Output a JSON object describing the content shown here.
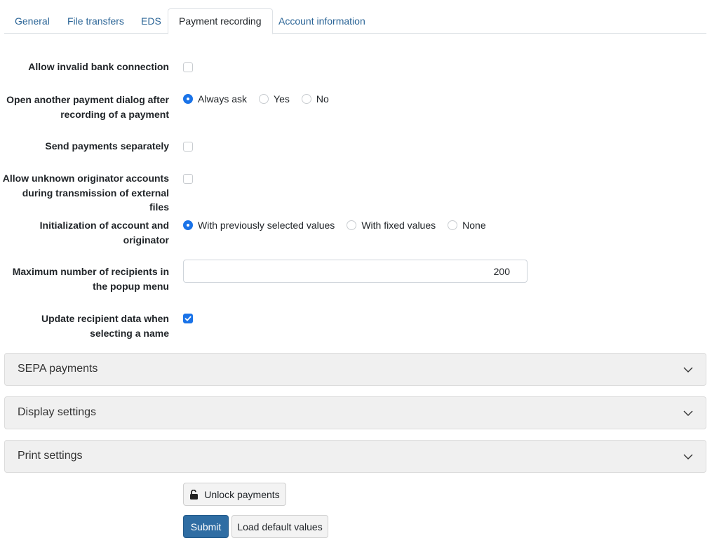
{
  "tabs": [
    {
      "label": "General",
      "active": false
    },
    {
      "label": "File transfers",
      "active": false
    },
    {
      "label": "EDS",
      "active": false
    },
    {
      "label": "Payment recording",
      "active": true
    },
    {
      "label": "Account information",
      "active": false
    }
  ],
  "form": {
    "allow_invalid_bank": {
      "label": "Allow invalid bank connection",
      "checked": false
    },
    "open_another_dialog": {
      "label_line1": "Open another payment dialog after",
      "label_line2": "recording of a payment",
      "options": [
        "Always ask",
        "Yes",
        "No"
      ],
      "selected": "Always ask"
    },
    "send_separately": {
      "label": "Send payments separately",
      "checked": false
    },
    "allow_unknown_originator": {
      "label_line1": "Allow unknown originator accounts",
      "label_line2": "during transmission of external files",
      "checked": false
    },
    "initialization": {
      "label_line1": "Initialization of account and",
      "label_line2": "originator",
      "options": [
        "With previously selected values",
        "With fixed values",
        "None"
      ],
      "selected": "With previously selected values"
    },
    "max_recipients": {
      "label_line1": "Maximum number of recipients in",
      "label_line2": "the popup menu",
      "value": "200"
    },
    "update_recipient": {
      "label_line1": "Update recipient data when",
      "label_line2": "selecting a name",
      "checked": true
    }
  },
  "sections": {
    "sepa": "SEPA payments",
    "display": "Display settings",
    "print": "Print settings"
  },
  "buttons": {
    "unlock": "Unlock payments",
    "submit": "Submit",
    "load_defaults": "Load default values"
  },
  "colors": {
    "accent": "#1a73e8",
    "link": "#2a6496",
    "primary_button": "#2f6da3"
  }
}
